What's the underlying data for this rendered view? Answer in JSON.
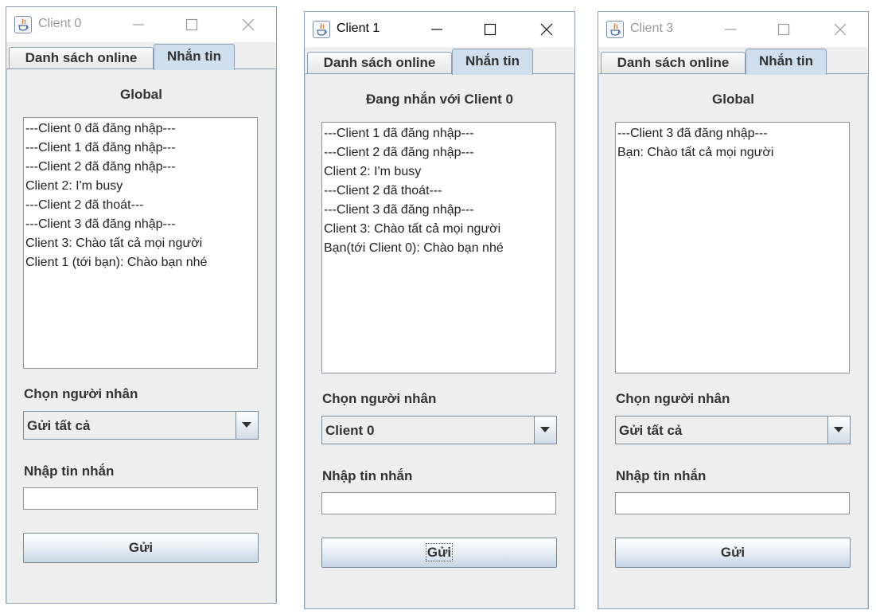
{
  "colors": {
    "active_tab": "#cfdfee",
    "border": "#8a9fb8",
    "panel_bg": "#eeeeee"
  },
  "windows": [
    {
      "title": "Client 0",
      "active": false,
      "tabs": [
        "Danh sách online",
        "Nhắn tin"
      ],
      "selected_tab": "Nhắn tin",
      "heading": "Global",
      "messages": [
        "---Client 0 đã đăng nhập---",
        "---Client 1 đã đăng nhập---",
        "---Client 2 đã đăng nhập---",
        "Client 2: I'm busy",
        "---Client 2 đã thoát---",
        "---Client 3 đã đăng nhập---",
        "Client 3: Chào tất cả mọi người",
        "Client 1 (tới bạn): Chào bạn nhé"
      ],
      "recipient_label": "Chọn người nhân",
      "recipient_value": "Gửi tất cả",
      "message_label": "Nhập tin nhắn",
      "message_value": "",
      "send_label": "Gửi"
    },
    {
      "title": "Client 1",
      "active": true,
      "tabs": [
        "Danh sách online",
        "Nhắn tin"
      ],
      "selected_tab": "Nhắn tin",
      "heading": "Đang nhắn với Client 0",
      "messages": [
        "---Client 1 đã đăng nhập---",
        "---Client 2 đã đăng nhập---",
        "Client 2: I'm busy",
        "---Client 2 đã thoát---",
        "---Client 3 đã đăng nhập---",
        "Client 3: Chào tất cả mọi người",
        "Bạn(tới Client 0): Chào bạn nhé"
      ],
      "recipient_label": "Chọn người nhân",
      "recipient_value": "Client 0",
      "message_label": "Nhập tin nhắn",
      "message_value": "",
      "send_label": "Gửi"
    },
    {
      "title": "Client 3",
      "active": false,
      "tabs": [
        "Danh sách online",
        "Nhắn tin"
      ],
      "selected_tab": "Nhắn tin",
      "heading": "Global",
      "messages": [
        "---Client 3 đã đăng nhập---",
        "Bạn: Chào tất cả mọi người"
      ],
      "recipient_label": "Chọn người nhân",
      "recipient_value": "Gửi tất cả",
      "message_label": "Nhập tin nhắn",
      "message_value": "",
      "send_label": "Gửi"
    }
  ]
}
